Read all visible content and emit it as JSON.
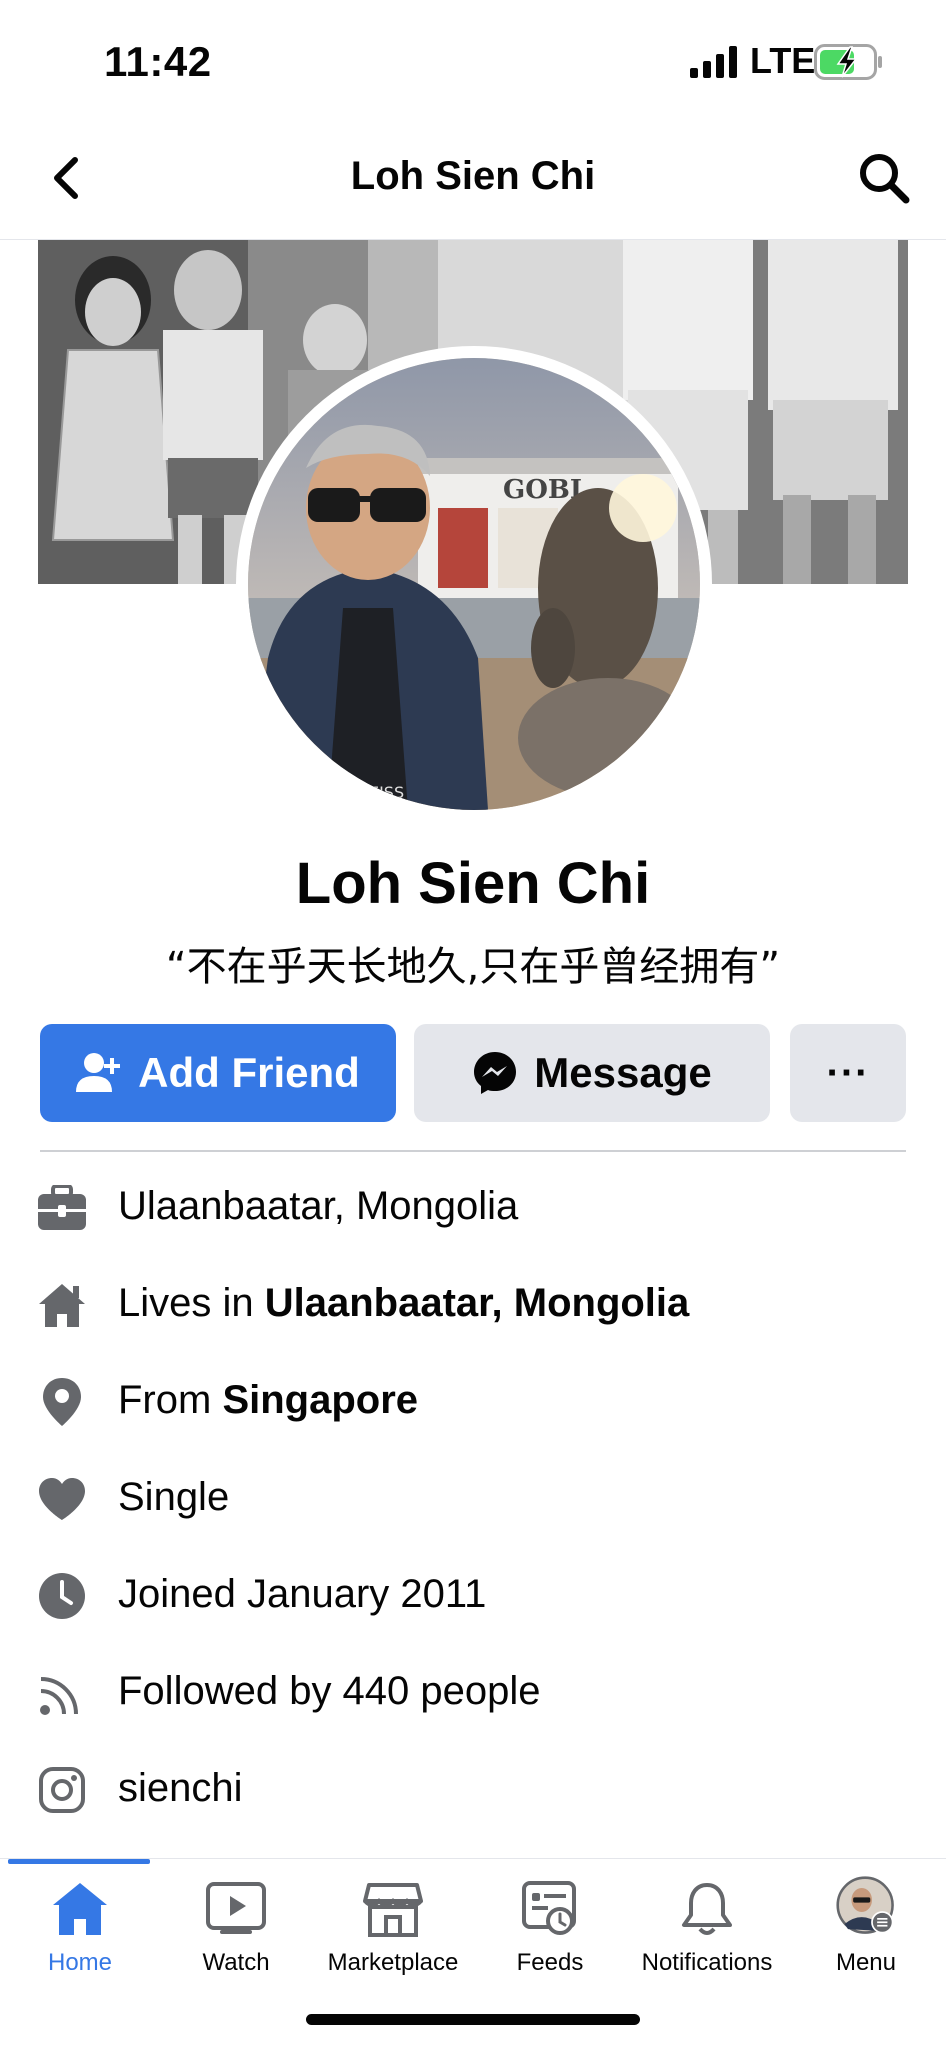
{
  "status_bar": {
    "time": "11:42",
    "network": "LTE",
    "battery_icon": "battery-charging-icon"
  },
  "header": {
    "title": "Loh Sien Chi"
  },
  "profile": {
    "name": "Loh Sien Chi",
    "bio": "“不在乎天长地久,只在乎曾经拥有”",
    "avatar_sign_text": "GOBI",
    "avatar_watermark": "ZEISS"
  },
  "actions": {
    "add_friend": "Add Friend",
    "message": "Message",
    "more": "···"
  },
  "info": {
    "work": "Ulaanbaatar, Mongolia",
    "lives_prefix": "Lives in ",
    "lives_place": "Ulaanbaatar, Mongolia",
    "from_prefix": "From ",
    "from_place": "Singapore",
    "relationship": "Single",
    "joined": "Joined January 2011",
    "followers": "Followed by 440 people",
    "instagram": "sienchi"
  },
  "tabs": [
    {
      "label": "Home",
      "icon": "home-icon",
      "active": true
    },
    {
      "label": "Watch",
      "icon": "watch-icon",
      "active": false
    },
    {
      "label": "Marketplace",
      "icon": "marketplace-icon",
      "active": false
    },
    {
      "label": "Feeds",
      "icon": "feeds-icon",
      "active": false
    },
    {
      "label": "Notifications",
      "icon": "bell-icon",
      "active": false
    },
    {
      "label": "Menu",
      "icon": "menu-avatar-icon",
      "active": false
    }
  ],
  "colors": {
    "accent": "#3578e5",
    "button_grey": "#e4e6eb",
    "icon_grey": "#65676b"
  }
}
